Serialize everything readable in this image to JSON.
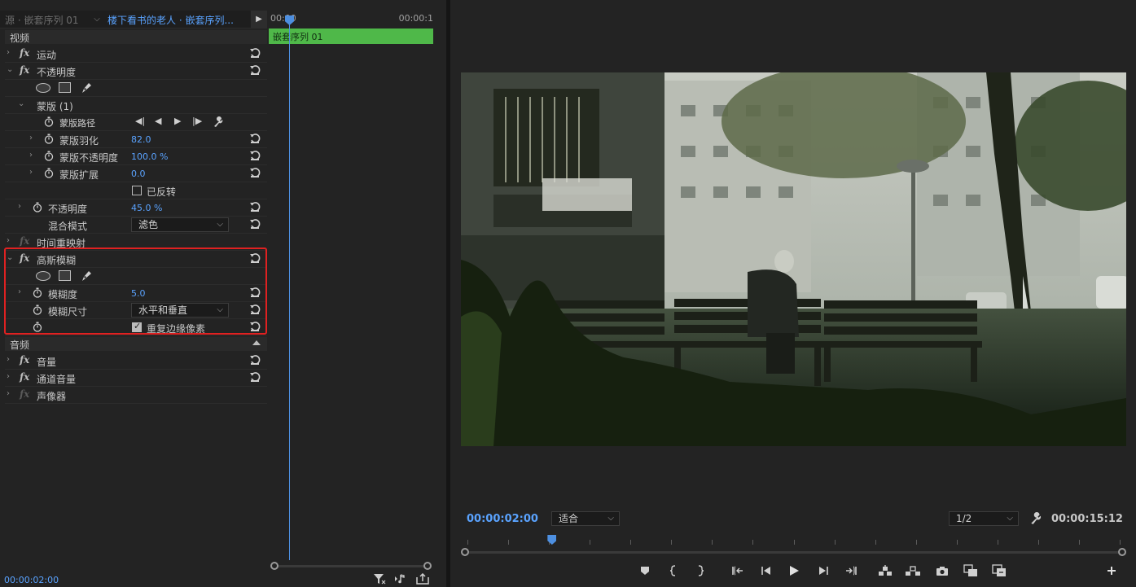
{
  "effect_controls": {
    "tabs": {
      "source": "源 · 嵌套序列 01",
      "sequence": "楼下看书的老人 · 嵌套序列..."
    },
    "sections": {
      "video": "视频",
      "audio": "音频"
    },
    "effects": {
      "motion": "运动",
      "opacity": "不透明度",
      "mask": "蒙版 (1)",
      "mask_path": "蒙版路径",
      "mask_feather": {
        "label": "蒙版羽化",
        "value": "82.0"
      },
      "mask_opacity": {
        "label": "蒙版不透明度",
        "value": "100.0 %"
      },
      "mask_expansion": {
        "label": "蒙版扩展",
        "value": "0.0"
      },
      "inverted": {
        "label": "已反转",
        "checked": false
      },
      "opacity_value": {
        "label": "不透明度",
        "value": "45.0 %"
      },
      "blend_mode": {
        "label": "混合模式",
        "value": "滤色"
      },
      "time_remap": "时间重映射",
      "gaussian_blur": "高斯模糊",
      "blurriness": {
        "label": "模糊度",
        "value": "5.0"
      },
      "blur_dimensions": {
        "label": "模糊尺寸",
        "value": "水平和垂直"
      },
      "repeat_edge": {
        "label": "重复边缘像素",
        "checked": true
      },
      "volume": "音量",
      "channel_volume": "通道音量",
      "panner": "声像器"
    },
    "timeline": {
      "start": "00:00",
      "end": "00:00:1",
      "clip_name": "嵌套序列 01"
    },
    "timecode": "00:00:02:00"
  },
  "program_monitor": {
    "timecode": "00:00:02:00",
    "fit": "适合",
    "resolution": "1/2",
    "duration": "00:00:15:12",
    "playhead_fraction": 0.129
  },
  "colors": {
    "accent_blue": "#5aa3ff",
    "clip_green": "#4fb849",
    "highlight_red": "#e02121",
    "panel_bg": "#232323"
  }
}
